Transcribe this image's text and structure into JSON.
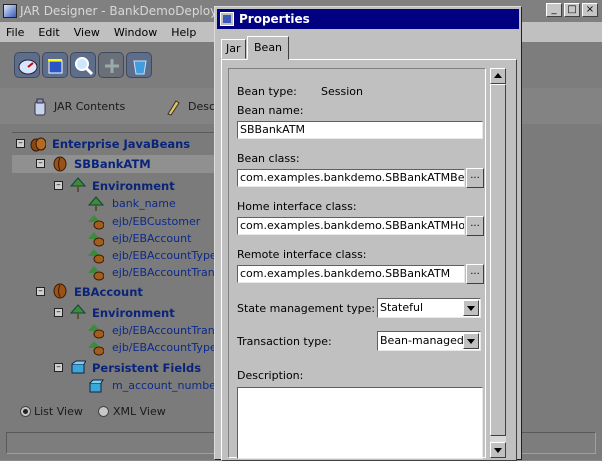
{
  "main": {
    "title": "JAR Designer - BankDemoDeploy",
    "menu": [
      "File",
      "Edit",
      "View",
      "Window",
      "Help"
    ],
    "tabs": [
      "JAR Contents",
      "Desc"
    ],
    "view_options": [
      "List View",
      "XML View"
    ],
    "selected_view": "List View"
  },
  "tree": {
    "root": "Enterprise JavaBeans",
    "bean1": "SBBankATM",
    "env1": "Environment",
    "env1_items": [
      "bank_name",
      "ejb/EBCustomer",
      "ejb/EBAccount",
      "ejb/EBAccountType",
      "ejb/EBAccountTransa"
    ],
    "bean2": "EBAccount",
    "env2": "Environment",
    "env2_items": [
      "ejb/EBAccountTransa",
      "ejb/EBAccountType"
    ],
    "persistent": "Persistent Fields",
    "field1": "m_account_number"
  },
  "dialog": {
    "title": "Properties",
    "tabs": [
      "Jar",
      "Bean"
    ],
    "active_tab": "Bean",
    "bean_type_label": "Bean type:",
    "bean_type_value": "Session",
    "bean_name_label": "Bean name:",
    "bean_name_value": "SBBankATM",
    "bean_class_label": "Bean class:",
    "bean_class_value": "com.examples.bankdemo.SBBankATMBean",
    "home_label": "Home interface class:",
    "home_value": "com.examples.bankdemo.SBBankATMHome",
    "remote_label": "Remote interface class:",
    "remote_value": "com.examples.bankdemo.SBBankATM",
    "state_label": "State management type:",
    "state_value": "Stateful",
    "transaction_label": "Transaction type:",
    "transaction_value": "Bean-managed",
    "description_label": "Description:",
    "description_value": "",
    "ellipsis": "..."
  },
  "colors": {
    "dialog_title_bg": "#000080",
    "tree_text": "#0c2a8a"
  }
}
